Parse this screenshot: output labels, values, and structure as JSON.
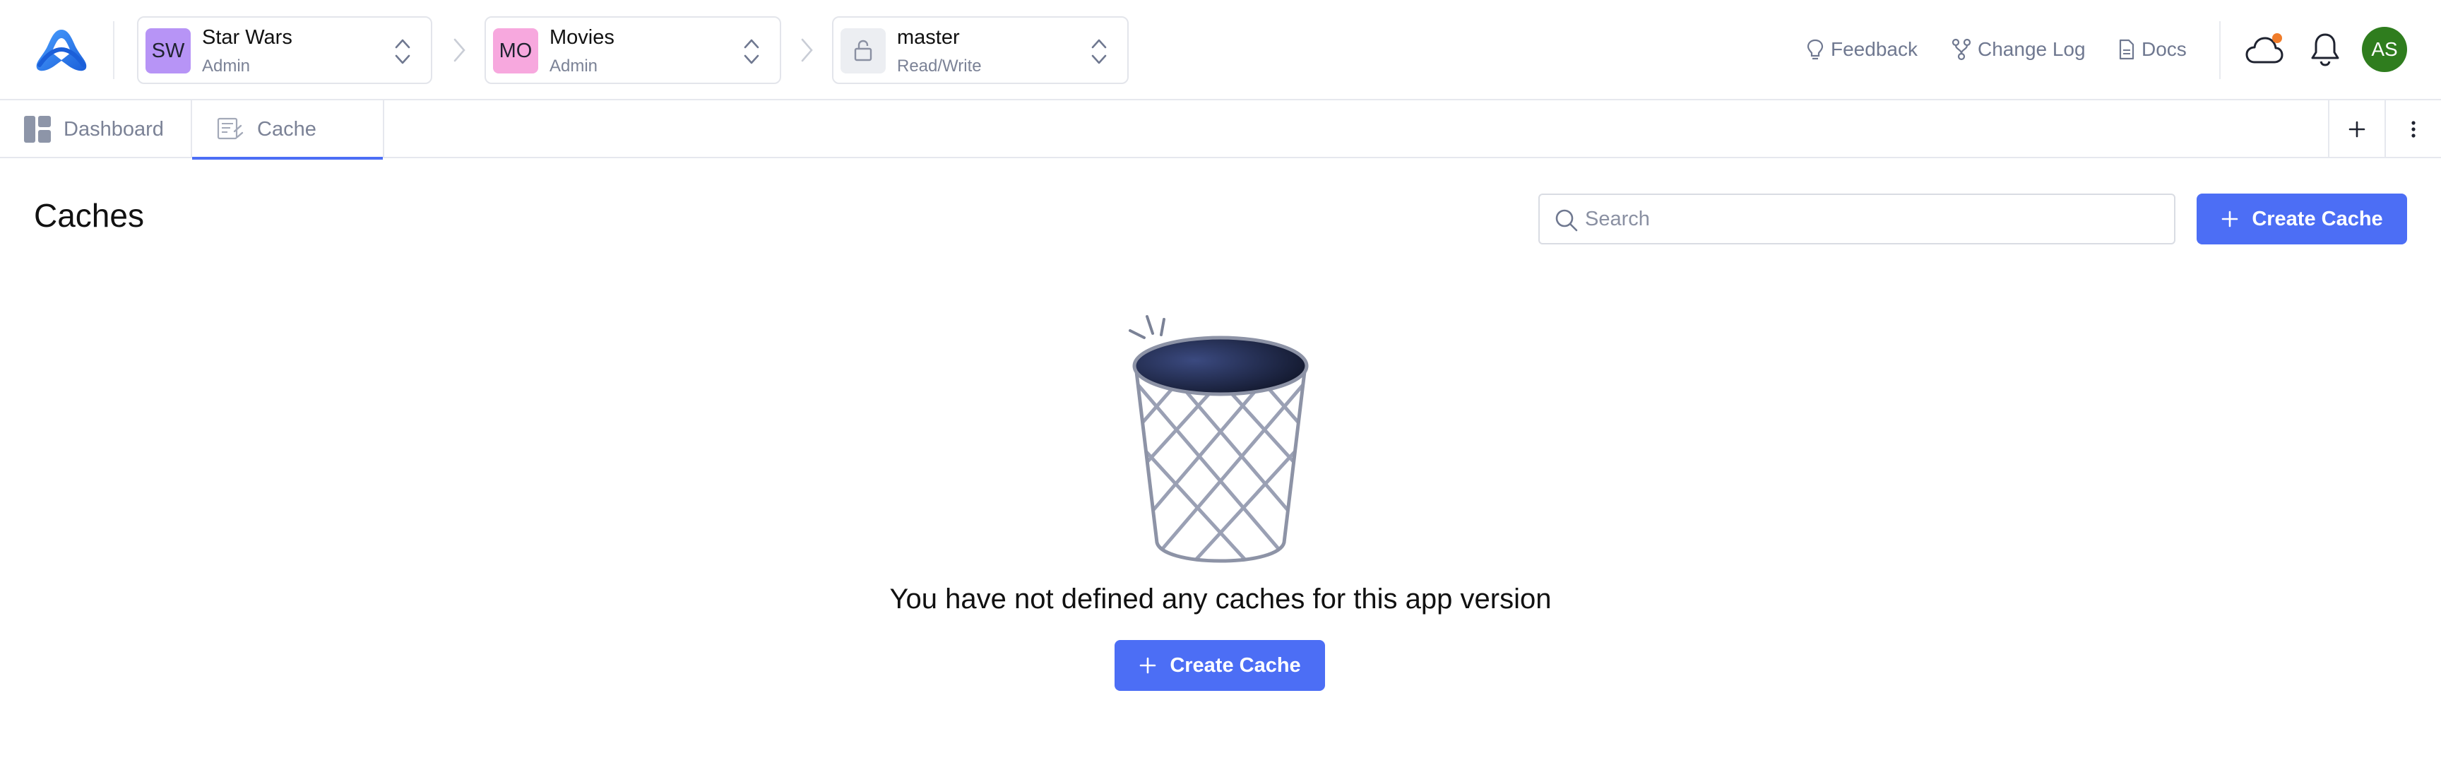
{
  "header": {
    "selectors": [
      {
        "badge": "SW",
        "name": "Star Wars",
        "role": "Admin",
        "badge_color": "#b794f6"
      },
      {
        "badge": "MO",
        "name": "Movies",
        "role": "Admin",
        "badge_color": "#f7a8de"
      },
      {
        "badge": "lock-icon",
        "name": "master",
        "role": "Read/Write",
        "badge_color": "#eceef2"
      }
    ],
    "links": {
      "feedback": "Feedback",
      "changelog": "Change Log",
      "docs": "Docs"
    },
    "avatar": "AS",
    "avatar_color": "#2f7d1e",
    "notification_dot_color": "#f07c2a"
  },
  "tabs": [
    {
      "label": "Dashboard",
      "icon": "dashboard-icon"
    },
    {
      "label": "Cache",
      "icon": "cache-icon",
      "active": true
    }
  ],
  "page": {
    "title": "Caches",
    "search_placeholder": "Search",
    "create_label": "Create Cache",
    "empty_message": "You have not defined any caches for this app version",
    "empty_create_label": "Create Cache"
  },
  "colors": {
    "accent": "#4c6ef5",
    "border": "#e6e8ee",
    "muted_text": "#7b8296"
  }
}
